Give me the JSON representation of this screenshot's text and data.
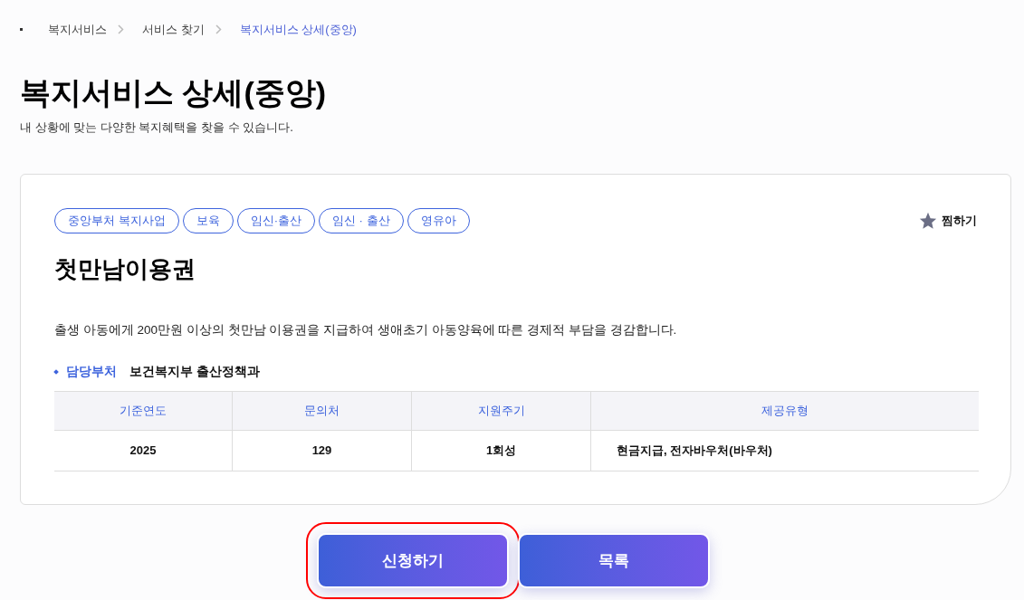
{
  "breadcrumb": [
    {
      "label": "복지서비스",
      "selected": false
    },
    {
      "label": "서비스 찾기",
      "selected": false
    },
    {
      "label": "복지서비스 상세(중앙)",
      "selected": true
    }
  ],
  "page": {
    "title": "복지서비스 상세(중앙)",
    "subtitle": "내 상황에 맞는 다양한 복지혜택을 찾을 수 있습니다."
  },
  "service": {
    "tags": [
      "중앙부처 복지사업",
      "보육",
      "임신·출산",
      "임신 · 출산",
      "영유아"
    ],
    "bookmark": {
      "label": "찜하기",
      "on": false
    },
    "name": "첫만남이용권",
    "description": "출생 아동에게 200만원 이상의 첫만남 이용권을 지급하여 생애초기 아동양육에 따른 경제적 부담을 경감합니다.",
    "department": {
      "label": "담당부처",
      "value": "보건복지부 출산정책과"
    },
    "table": {
      "columns": [
        "기준연도",
        "문의처",
        "지원주기",
        "제공유형"
      ],
      "rows": [
        [
          "2025",
          "129",
          "1회성",
          "현금지급, 전자바우처(바우처)"
        ]
      ]
    }
  },
  "buttons": [
    {
      "label": "신청하기",
      "highlighted": true
    },
    {
      "label": "목록",
      "highlighted": false
    }
  ]
}
